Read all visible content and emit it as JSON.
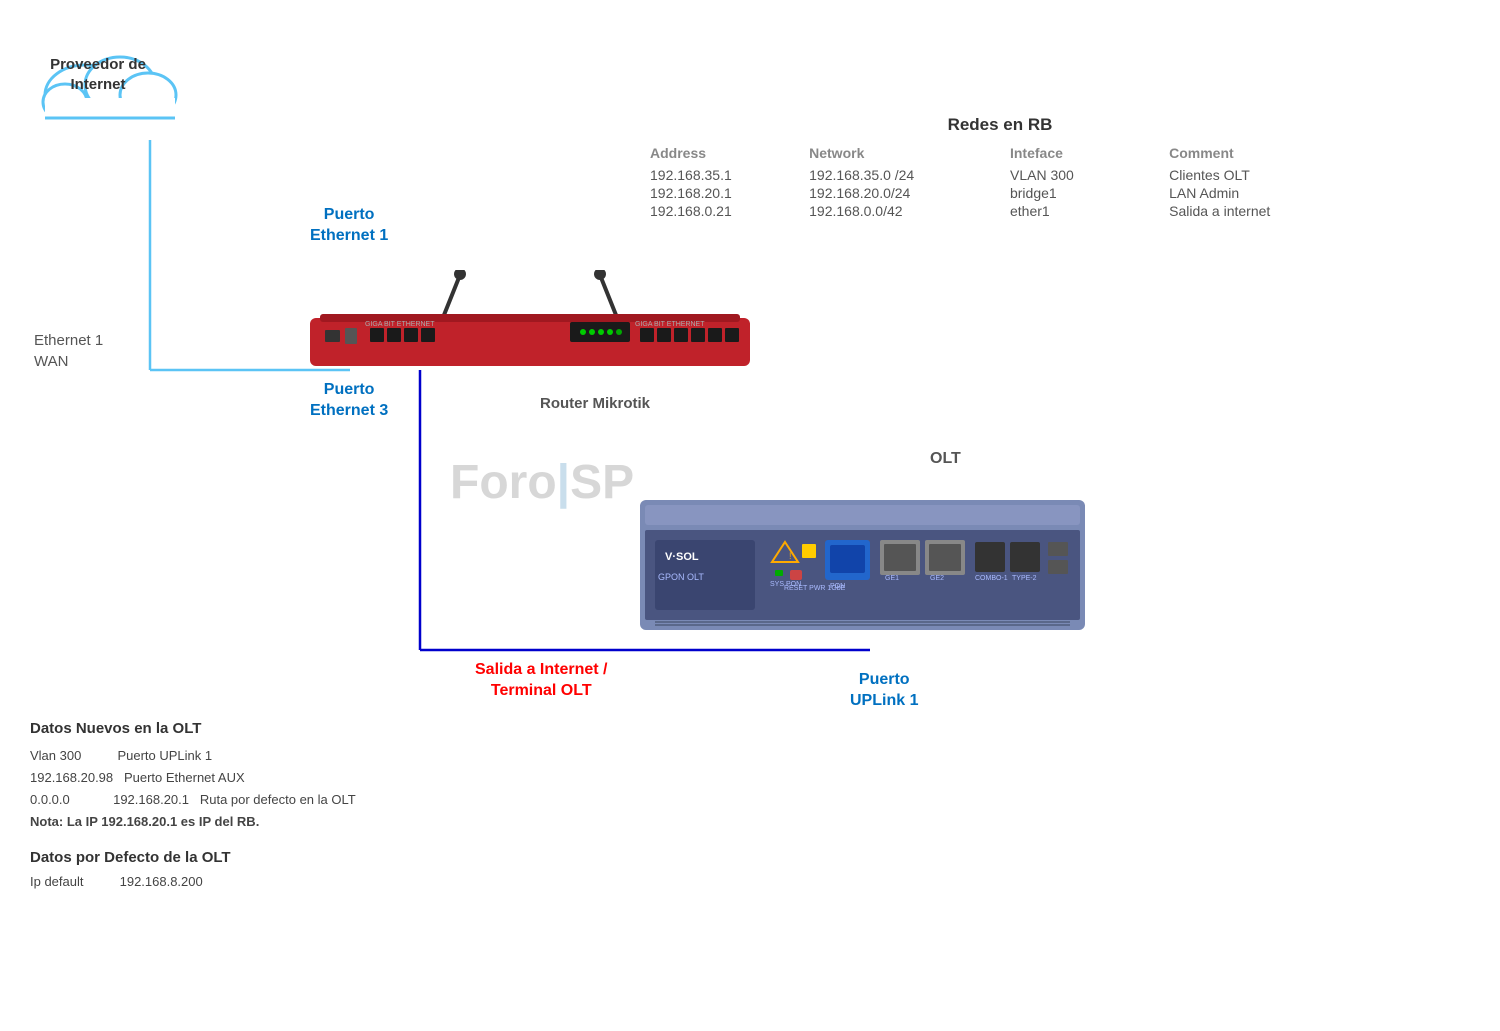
{
  "cloud": {
    "label_line1": "Proveedor de",
    "label_line2": "Internet"
  },
  "labels": {
    "eth1_wan_line1": "Ethernet 1",
    "eth1_wan_line2": "WAN",
    "puerto_eth1_line1": "Puerto",
    "puerto_eth1_line2": "Ethernet 1",
    "puerto_eth3_line1": "Puerto",
    "puerto_eth3_line2": "Ethernet 3",
    "router_mikrotik": "Router Mikrotik",
    "olt": "OLT",
    "puerto_uplink_line1": "Puerto",
    "puerto_uplink_line2": "UPLink 1",
    "salida_internet_line1": "Salida a Internet /",
    "salida_internet_line2": "Terminal  OLT",
    "foro_isp": "Foro|SP"
  },
  "redes_rb": {
    "title": "Redes en RB",
    "headers": [
      "Address",
      "Network",
      "Inteface",
      "Comment"
    ],
    "rows": [
      [
        "192.168.35.1",
        "192.168.35.0 /24",
        "VLAN 300",
        "Clientes OLT"
      ],
      [
        "192.168.20.1",
        "192.168.20.0/24",
        "bridge1",
        "LAN Admin"
      ],
      [
        "192.168.0.21",
        "192.168.0.0/42",
        "ether1",
        "Salida a internet"
      ]
    ]
  },
  "datos_nuevos": {
    "title": "Datos Nuevos en  la OLT",
    "lines": [
      "Vlan 300          Puerto UPLink 1",
      "192.168.20.98    Puerto Ethernet AUX",
      "0.0.0.0            192.168.20.1    Ruta  por defecto en la OLT",
      "Nota: La IP 192.168.20.1 es IP del RB."
    ]
  },
  "datos_defecto": {
    "title": "Datos por Defecto de la OLT",
    "lines": [
      "Ip default          192.168.8.200"
    ]
  }
}
